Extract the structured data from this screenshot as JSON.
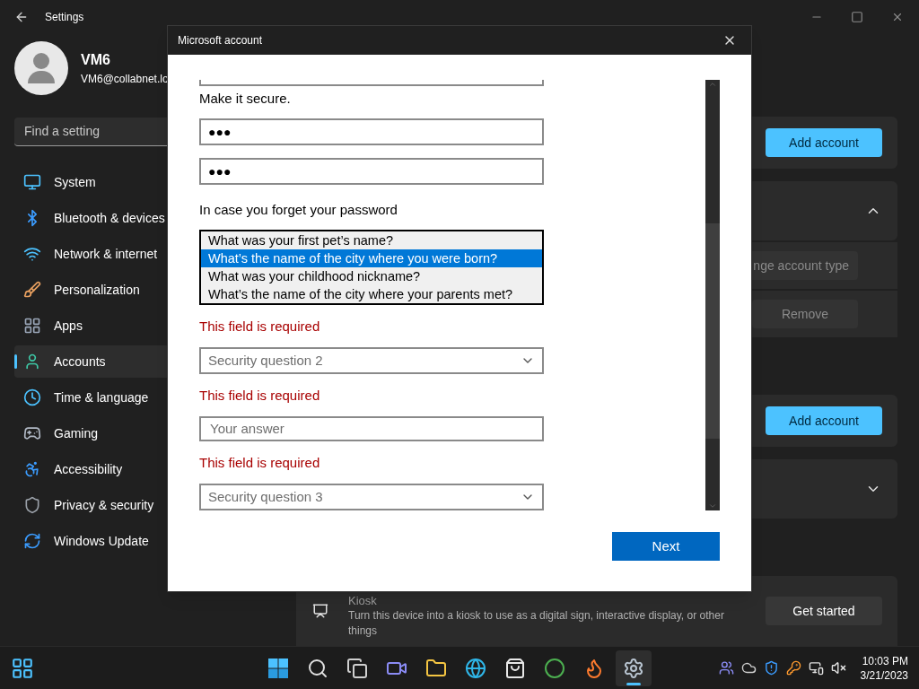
{
  "settings": {
    "title": "Settings",
    "user": {
      "name": "VM6",
      "email": "VM6@collabnet.lo"
    },
    "search": {
      "placeholder": "Find a setting"
    },
    "nav": [
      {
        "label": "System",
        "selected": false
      },
      {
        "label": "Bluetooth & devices",
        "selected": false
      },
      {
        "label": "Network & internet",
        "selected": false
      },
      {
        "label": "Personalization",
        "selected": false
      },
      {
        "label": "Apps",
        "selected": false
      },
      {
        "label": "Accounts",
        "selected": true
      },
      {
        "label": "Time & language",
        "selected": false
      },
      {
        "label": "Gaming",
        "selected": false
      },
      {
        "label": "Accessibility",
        "selected": false
      },
      {
        "label": "Privacy & security",
        "selected": false
      },
      {
        "label": "Windows Update",
        "selected": false
      }
    ],
    "groups": [
      [
        {
          "kind": "action",
          "button": "Add account"
        },
        {
          "kind": "expander",
          "expanded": true,
          "rows": [
            "nge account type",
            "Remove"
          ]
        }
      ],
      [
        {
          "kind": "action",
          "button": "Add account"
        },
        {
          "kind": "expander",
          "expanded": false
        }
      ],
      [
        {
          "kind": "kiosk",
          "title": "Kiosk",
          "description": "Turn this device into a kiosk to use as a digital sign, interactive display, or other things",
          "button": "Get started"
        }
      ]
    ]
  },
  "dialog": {
    "title": "Microsoft account",
    "form": [
      {
        "kind": "partial"
      },
      {
        "kind": "label",
        "text": "Make it secure."
      },
      {
        "kind": "password",
        "value": "●●●"
      },
      {
        "kind": "password",
        "value": "●●●"
      },
      {
        "kind": "label",
        "text": "In case you forget your password"
      },
      {
        "kind": "listbox",
        "options": [
          {
            "label": "What was your first pet’s name?",
            "selected": false
          },
          {
            "label": "What’s the name of the city where you were born?",
            "selected": true
          },
          {
            "label": "What was your childhood nickname?",
            "selected": false
          },
          {
            "label": "What’s the name of the city where your parents met?",
            "selected": false
          }
        ]
      },
      {
        "kind": "error",
        "text": "This field is required"
      },
      {
        "kind": "select",
        "placeholder": "Security question 2"
      },
      {
        "kind": "error",
        "text": "This field is required"
      },
      {
        "kind": "input",
        "placeholder": "Your answer"
      },
      {
        "kind": "error",
        "text": "This field is required"
      },
      {
        "kind": "select",
        "placeholder": "Security question 3"
      }
    ],
    "next": "Next"
  },
  "taskbar": {
    "apps": [
      {
        "selected": false
      },
      {
        "selected": false
      },
      {
        "selected": false
      },
      {
        "selected": false
      },
      {
        "selected": false
      },
      {
        "selected": false
      },
      {
        "selected": false
      },
      {
        "selected": false
      },
      {
        "selected": false
      },
      {
        "selected": true
      }
    ],
    "time": "10:03 PM",
    "date": "3/21/2023"
  }
}
